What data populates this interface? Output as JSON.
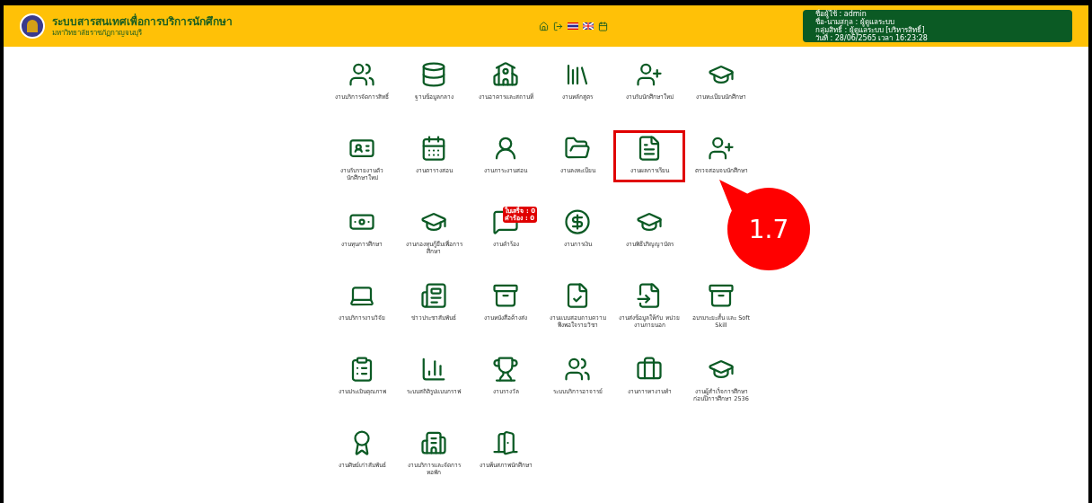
{
  "header": {
    "title": "ระบบสารสนเทศเพื่อการบริการนักศึกษา",
    "subtitle": "มหาวิทยาลัยราชภัฏกาญจนบุรี"
  },
  "user_info": [
    "ชื่อผู้ใช้ : admin",
    "ชื่อ-นามสกุล : ผู้ดูแลระบบ",
    "กลุ่มสิทธิ์ : ผู้ดูแลระบบ [บริหารสิทธิ์]",
    "วันที่ : 28/06/2565 เวลา 16:23:28"
  ],
  "menu": [
    {
      "kind": "item",
      "label": "งานบริการจัดการสิทธิ์",
      "selected": false
    },
    {
      "kind": "item",
      "label": "ฐานข้อมูลกลาง",
      "selected": false
    },
    {
      "kind": "item",
      "label": "งานอาคารและสถานที่",
      "selected": false
    },
    {
      "kind": "item",
      "label": "งานหลักสูตร",
      "selected": false
    },
    {
      "kind": "item",
      "label": "งานรับนักศึกษาใหม่",
      "selected": false
    },
    {
      "kind": "item",
      "label": "งานทะเบียนนักศึกษา",
      "selected": false
    },
    {
      "kind": "item",
      "label": "งานรับรายงานตัว นักศึกษาใหม่",
      "selected": false
    },
    {
      "kind": "item",
      "label": "งานตารางสอน",
      "selected": false
    },
    {
      "kind": "item",
      "label": "งานภาระงานสอน",
      "selected": false
    },
    {
      "kind": "item",
      "label": "งานลงทะเบียน",
      "selected": false
    },
    {
      "kind": "item",
      "label": "งานผลการเรียน",
      "selected": true
    },
    {
      "kind": "item",
      "label": "ตรวจสอบจบนักศึกษา",
      "selected": false
    },
    {
      "kind": "item",
      "label": "งานทุนการศึกษา",
      "selected": false
    },
    {
      "kind": "item",
      "label": "งานกองทุนกู้ยืมเพื่อการ ศึกษา",
      "selected": false
    },
    {
      "kind": "item",
      "label": "งานคำร้อง",
      "selected": false,
      "badge": [
        "ใบเสร็จ : 0",
        "คำร้อง : 0"
      ]
    },
    {
      "kind": "item",
      "label": "งานการเงิน",
      "selected": false
    },
    {
      "kind": "item",
      "label": "งานพิธีปริญญาบัตร",
      "selected": false
    },
    {
      "kind": "covered"
    },
    {
      "kind": "item",
      "label": "งานบริการงานวิจัย",
      "selected": false
    },
    {
      "kind": "item",
      "label": "ข่าวประชาสัมพันธ์",
      "selected": false
    },
    {
      "kind": "item",
      "label": "งานหนังสือค้างส่ง",
      "selected": false
    },
    {
      "kind": "item",
      "label": "งานแบบสอบถามความ พึงพอใจรายวิชา",
      "selected": false
    },
    {
      "kind": "item",
      "label": "งานส่งข้อมูลให้กับ หน่วยงานภายนอก",
      "selected": false
    },
    {
      "kind": "item",
      "label": "อบรมระยะสั้น และ Soft Skill",
      "selected": false
    },
    {
      "kind": "item",
      "label": "งานประเมินคุณภาพ",
      "selected": false
    },
    {
      "kind": "item",
      "label": "ระบบสถิติรูปแบบกราฟ",
      "selected": false
    },
    {
      "kind": "item",
      "label": "งานรางวัล",
      "selected": false
    },
    {
      "kind": "item",
      "label": "ระบบบริการอาจารย์",
      "selected": false
    },
    {
      "kind": "item",
      "label": "งานการหางานทำ",
      "selected": false
    },
    {
      "kind": "item",
      "label": "งานผู้สำเร็จการศึกษา ก่อนปีการศึกษา 2536",
      "selected": false
    },
    {
      "kind": "item",
      "label": "งานศิษย์เก่าสัมพันธ์",
      "selected": false
    },
    {
      "kind": "item",
      "label": "งานบริการและจัดการ หอพัก",
      "selected": false
    },
    {
      "kind": "item",
      "label": "งานพ้นสภาพนักศึกษา",
      "selected": false
    }
  ],
  "callout": {
    "label": "1.7"
  }
}
